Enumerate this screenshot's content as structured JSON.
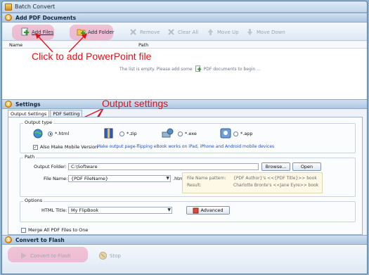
{
  "window": {
    "title": "Batch Convert"
  },
  "section1": {
    "num": "1",
    "title": "Add PDF Documents"
  },
  "toolbar": {
    "add_files": "Add Files",
    "add_folder": "Add Folder",
    "remove": "Remove",
    "clear_all": "Clear All",
    "move_up": "Move Up",
    "move_down": "Move Down"
  },
  "list": {
    "col_name": "Name",
    "col_path": "Path",
    "empty_text": "The list is empty. Please add some",
    "empty_text2": "PDF documents to begin ..."
  },
  "annotations": {
    "add_ppt": "Click to add PowerPoint file",
    "output_settings": "Output settings"
  },
  "section2": {
    "num": "2",
    "title": "Settings"
  },
  "tabs": [
    "Output Settings",
    "PDF Setting"
  ],
  "output_type": {
    "label": "Output type",
    "options": [
      "*.html",
      "*.zip",
      "*.exe",
      "*.app"
    ],
    "selected": "*.html",
    "mobile_label": "Also Make Mobile Version",
    "mobile_checked": true,
    "mobile_link": "Make output page-flipping eBook works on iPad, iPhone and Android mobile devices"
  },
  "path": {
    "label": "Path",
    "output_folder_label": "Output Folder:",
    "output_folder_value": "C:\\Software",
    "browse": "Browse...",
    "open": "Open",
    "file_name_label": "File Name:",
    "file_name_value": "{PDF FileName}",
    "file_ext": ".html",
    "pattern_label": "File Name pattern:",
    "pattern_value": "{PDF Author}'s <<{PDF Title}>> book",
    "result_label": "Result:",
    "result_value": "Charlotte Bronte's <<Jane Eyre>> book"
  },
  "options": {
    "label": "Options",
    "html_title_label": "HTML Title:",
    "html_title_value": "My FlipBook",
    "advanced": "Advanced"
  },
  "merge": {
    "label": "Merge All PDF Files to One",
    "checked": false
  },
  "section3": {
    "num": "3",
    "title": "Convert to Flash"
  },
  "bottom": {
    "convert": "Convert to Flash",
    "stop": "Stop"
  },
  "colors": {
    "accent_red": "#e0121a",
    "highlight": "#f096b4",
    "link_blue": "#1d4fc4"
  }
}
